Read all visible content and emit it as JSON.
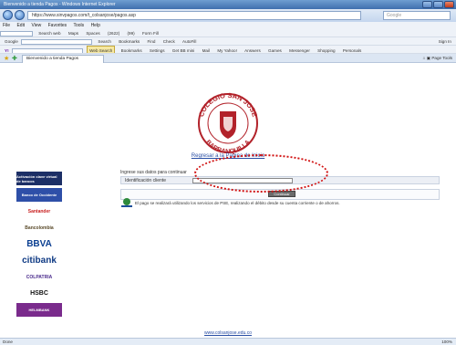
{
  "window": {
    "title": "Bienvenido a tienda Pagos - Windows Internet Explorer"
  },
  "address_bar": {
    "url": "https://www.sinvpagos.com/t_colsanjose/pagos.asp",
    "search_placeholder": "Google"
  },
  "menu": {
    "items": [
      "File",
      "Edit",
      "View",
      "Favorites",
      "Tools",
      "Help"
    ]
  },
  "toolbar1": {
    "items": [
      "Search web",
      "Maps",
      "Spaces",
      "(2622)",
      "(99)",
      "Form Fill"
    ]
  },
  "toolbar2": {
    "google_label": "Google",
    "items": [
      "Search",
      "Bookmarks",
      "Find",
      "Check",
      "AutoFill"
    ],
    "signin": "Sign In"
  },
  "toolbar3": {
    "web_search": "Web Search",
    "items": [
      "Bookmarks",
      "Settings",
      "Get BB mini",
      "Mail",
      "My Yahoo!",
      "Answers",
      "Games",
      "Messenger",
      "Shopping",
      "Personals"
    ]
  },
  "tab": {
    "label": "Bienvenido a tienda Pagos",
    "right_items": [
      "Page",
      "Tools"
    ]
  },
  "page": {
    "logo_text_top": "COLEGIO SAN JOSE",
    "logo_text_bottom": "BARRANQUILLA",
    "return_link": "Regresar a la Pagina de Inicio",
    "form_intro": "Ingrese sus datos para continuar",
    "form_label": "Identificación cliente",
    "continue_label": "Continuar",
    "pse_text": "El pago se realizará utilizando los servicios de PSE, realizando el débito desde su cuenta corriente o de ahorros.",
    "footer_link": "www.colsanjose.edu.co"
  },
  "banks": [
    {
      "name": "Aval",
      "label": "Activación clave virtual de bancos"
    },
    {
      "name": "Occidente",
      "label": "Banco de Occidente"
    },
    {
      "name": "Santander",
      "label": "Santander"
    },
    {
      "name": "Bancolombia",
      "label": "Bancolombia"
    },
    {
      "name": "BBVA",
      "label": "BBVA"
    },
    {
      "name": "Citibank",
      "label": "citibank"
    },
    {
      "name": "Colpatria",
      "label": "COLPATRIA"
    },
    {
      "name": "HSBC",
      "label": "HSBC"
    },
    {
      "name": "Helm",
      "label": "HELMBANK"
    }
  ],
  "status": {
    "text": "Done",
    "zoom": "100%"
  },
  "colors": {
    "link": "#2a4fa5",
    "oval": "#d11212",
    "logo_red": "#b2222a"
  }
}
